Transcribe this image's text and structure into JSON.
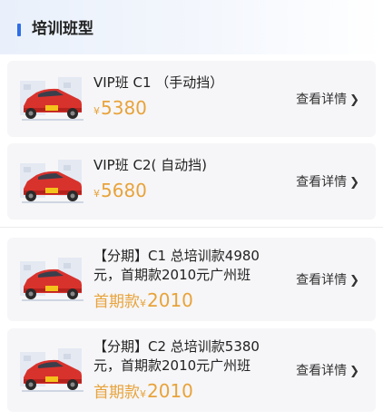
{
  "section": {
    "title": "培训班型"
  },
  "courses": [
    {
      "name": "VIP班 C1 （手动挡）",
      "price_prefix": "",
      "currency": "¥",
      "price": "5380",
      "more": "查看详情"
    },
    {
      "name": "VIP班 C2( 自动挡)",
      "price_prefix": "",
      "currency": "¥",
      "price": "5680",
      "more": "查看详情"
    },
    {
      "name": "【分期】C1 总培训款4980元，首期款2010元广州班",
      "price_prefix": "首期款",
      "currency": "¥",
      "price": "2010",
      "more": "查看详情"
    },
    {
      "name": "【分期】C2 总培训款5380元，首期款2010元广州班",
      "price_prefix": "首期款",
      "currency": "¥",
      "price": "2010",
      "more": "查看详情"
    }
  ],
  "colors": {
    "accent": "#2f6ee8",
    "price": "#e8a33a",
    "car": "#d8322d"
  },
  "icons": {
    "thumbnail": "red-car-icon",
    "more": "chevron-right-icon"
  }
}
